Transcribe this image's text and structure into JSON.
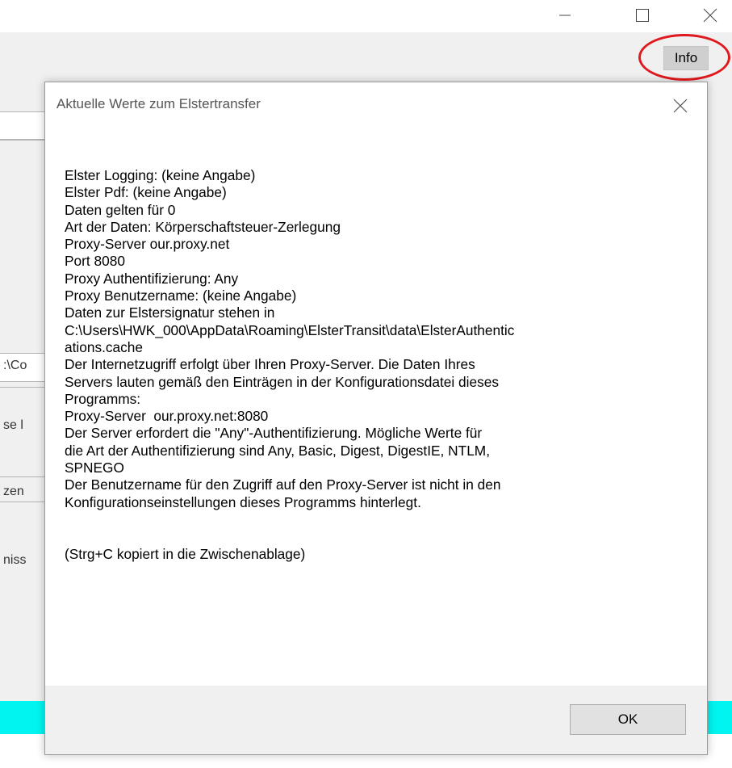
{
  "window": {
    "info_button": "Info",
    "minimize_icon": "minimize-icon",
    "maximize_icon": "maximize-icon",
    "close_icon": "close-icon"
  },
  "background_fragments": [
    ":\\Co",
    "se l",
    "zen",
    "niss"
  ],
  "dialog": {
    "title": "Aktuelle Werte zum Elstertransfer",
    "lines": [
      "Elster Logging: (keine Angabe)",
      "Elster Pdf: (keine Angabe)",
      "Daten gelten für 0",
      "Art der Daten: Körperschaftsteuer-Zerlegung",
      "Proxy-Server our.proxy.net",
      "Port 8080",
      "Proxy Authentifizierung: Any",
      "Proxy Benutzername: (keine Angabe)",
      "Daten zur Elstersignatur stehen in",
      "C:\\Users\\HWK_000\\AppData\\Roaming\\ElsterTransit\\data\\ElsterAuthentic",
      "ations.cache",
      "Der Internetzugriff erfolgt über Ihren Proxy-Server. Die Daten Ihres",
      "Servers lauten gemäß den Einträgen in der Konfigurationsdatei dieses",
      "Programms:",
      "Proxy-Server  our.proxy.net:8080",
      "Der Server erfordert die \"Any\"-Authentifizierung. Mögliche Werte für",
      "die Art der Authentifizierung sind Any, Basic, Digest, DigestIE, NTLM,",
      "SPNEGO",
      "Der Benutzername für den Zugriff auf den Proxy-Server ist nicht in den",
      "Konfigurationseinstellungen dieses Programms hinterlegt."
    ],
    "hint": "(Strg+C kopiert in die Zwischenablage)",
    "ok_button": "OK"
  },
  "colors": {
    "highlight_ring": "#e0191e",
    "cyan_bar": "#00f5f0",
    "panel": "#f0f0f0"
  }
}
